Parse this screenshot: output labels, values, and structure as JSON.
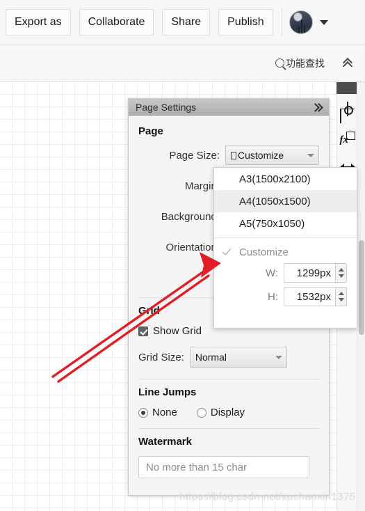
{
  "toolbar": {
    "buttons": [
      {
        "label": "Export as",
        "name": "export-as-button"
      },
      {
        "label": "Collaborate",
        "name": "collaborate-button"
      },
      {
        "label": "Share",
        "name": "share-button"
      },
      {
        "label": "Publish",
        "name": "publish-button"
      }
    ],
    "avatar_icon": "user-avatar",
    "caret_icon": "caret-down-icon"
  },
  "searchbar": {
    "icon": "search-icon",
    "label": "功能查找",
    "collapse_icon": "chevron-double-up-icon"
  },
  "rail": {
    "icons": [
      {
        "name": "target-crosshair-icon"
      },
      {
        "name": "fx-function-icon",
        "glyph": "fx"
      },
      {
        "name": "horizontal-resize-arrows-icon"
      }
    ]
  },
  "panel": {
    "title": "Page Settings",
    "collapse_icon": "chevron-double-right-icon",
    "sections": {
      "page": {
        "heading": "Page",
        "page_size_label": "Page Size:",
        "page_size_value": "Customize",
        "margin_label": "Margin:",
        "background_label": "Background:",
        "orientation_label": "Orientation:"
      },
      "grid": {
        "heading": "Grid",
        "show_grid_label": "Show Grid",
        "show_grid_checked": "true",
        "grid_size_label": "Grid Size:",
        "grid_size_value": "Normal"
      },
      "line_jumps": {
        "heading": "Line Jumps",
        "option_none": "None",
        "option_display": "Display",
        "selected": "None"
      },
      "watermark": {
        "heading": "Watermark",
        "placeholder": "No more than 15 char",
        "value": ""
      }
    }
  },
  "page_size_dropdown": {
    "options": [
      {
        "label": "A3(1500x2100)",
        "selected": "false"
      },
      {
        "label": "A4(1050x1500)",
        "selected": "true"
      },
      {
        "label": "A5(750x1050)",
        "selected": "false"
      }
    ],
    "customize_label": "Customize",
    "customize_checked": "true",
    "width_label": "W:",
    "width_value": "1299px",
    "height_label": "H:",
    "height_value": "1532px",
    "check_icon": "checkmark-icon",
    "spinner_icon": "spinner-arrows-icon"
  },
  "annotation": {
    "arrow_color": "#e11d26",
    "arrow_name": "red-pointer-arrow"
  },
  "watermark_url": "https://blog.csdn.net/xuchaoxin1375",
  "colors": {
    "panel_bg": "#f5f5f5",
    "header_gray": "#aeaeae",
    "accent_red": "#e11d26",
    "grid_line": "#ededed"
  }
}
